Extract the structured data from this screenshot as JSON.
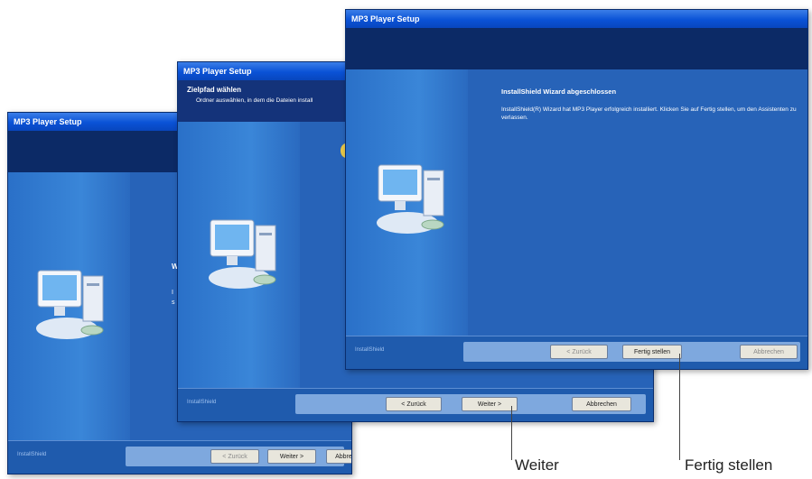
{
  "windows": {
    "win1": {
      "title": "MP3 Player Setup",
      "footer_brand": "InstallShield",
      "buttons": {
        "back": "< Zurück",
        "next": "Weiter >",
        "cancel": "Abbrechen"
      },
      "body_fragments": [
        "W",
        "I",
        "s"
      ]
    },
    "win2": {
      "title": "MP3 Player Setup",
      "banner_title": "Zielpfad wählen",
      "banner_subtitle": "Ordner auswählen, in dem die Dateien install",
      "footer_brand": "InstallShield",
      "buttons": {
        "back": "< Zurück",
        "next": "Weiter >",
        "cancel": "Abbrechen"
      }
    },
    "win3": {
      "title": "MP3 Player Setup",
      "heading": "InstallShield Wizard abgeschlossen",
      "message": "InstallShield(R) Wizard hat MP3 Player erfolgreich installiert. Klicken Sie auf Fertig stellen, um den Assistenten zu verlassen.",
      "footer_brand": "InstallShield",
      "buttons": {
        "back": "< Zurück",
        "finish": "Fertig stellen",
        "cancel": "Abbrechen"
      }
    }
  },
  "callouts": {
    "weiter": "Weiter",
    "fertig": "Fertig stellen"
  }
}
